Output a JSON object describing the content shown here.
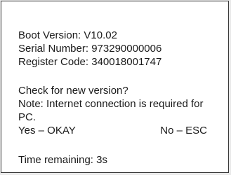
{
  "dialog": {
    "info": {
      "boot_version": "Boot Version: V10.02",
      "serial_number": "Serial Number: 973290000006",
      "register_code": "Register Code: 340018001747"
    },
    "update_prompt": {
      "question": "Check for new version?",
      "note": "Note: Internet connection is required for PC.",
      "yes_option": "Yes – OKAY",
      "no_option": "No – ESC"
    },
    "countdown": {
      "text": "Time remaining: 3s"
    }
  }
}
